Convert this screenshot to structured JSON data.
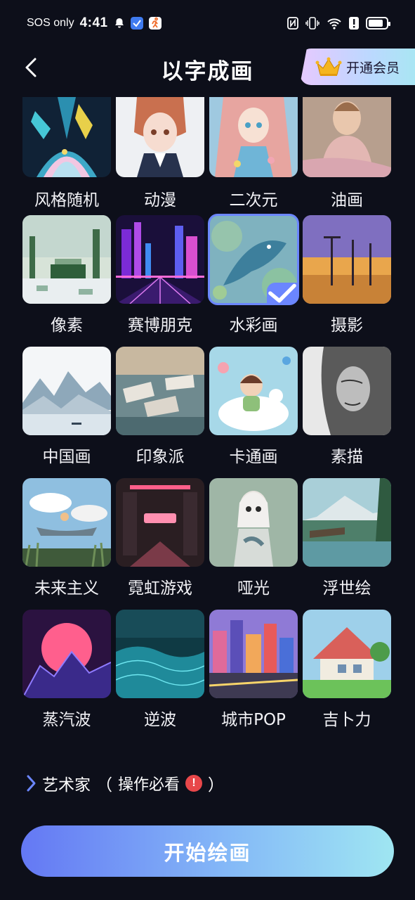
{
  "status_bar": {
    "carrier": "SOS only",
    "time": "4:41",
    "icons": [
      "bell-icon",
      "app-badge-icon",
      "runner-app-icon",
      "nfc-icon",
      "vibrate-icon",
      "wifi-icon",
      "alert-icon",
      "battery-icon"
    ]
  },
  "header": {
    "back_icon": "chevron-left-icon",
    "title": "以字成画",
    "vip_label": "开通会员",
    "vip_icon": "crown-icon"
  },
  "styles": [
    {
      "label": "风格随机"
    },
    {
      "label": "动漫"
    },
    {
      "label": "二次元"
    },
    {
      "label": "油画"
    },
    {
      "label": "像素"
    },
    {
      "label": "赛博朋克"
    },
    {
      "label": "水彩画",
      "selected": true
    },
    {
      "label": "摄影"
    },
    {
      "label": "中国画"
    },
    {
      "label": "印象派"
    },
    {
      "label": "卡通画"
    },
    {
      "label": "素描"
    },
    {
      "label": "未来主义"
    },
    {
      "label": "霓虹游戏"
    },
    {
      "label": "哑光"
    },
    {
      "label": "浮世绘"
    },
    {
      "label": "蒸汽波"
    },
    {
      "label": "逆波"
    },
    {
      "label": "城市POP"
    },
    {
      "label": "吉卜力"
    }
  ],
  "artist": {
    "label": "艺术家",
    "open_paren": "（",
    "hint": "操作必看",
    "close_paren": "）",
    "alert_glyph": "!"
  },
  "start_button": {
    "label": "开始绘画"
  },
  "colors": {
    "accent": "#6b86ff",
    "background": "#0d0f1a",
    "alert": "#e8474a"
  }
}
